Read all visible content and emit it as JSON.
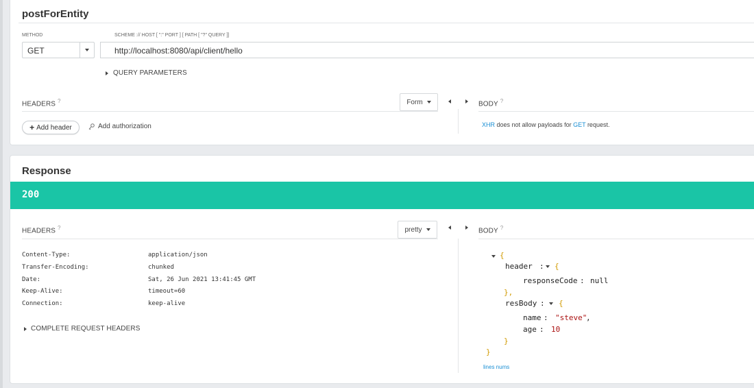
{
  "request": {
    "title": "postForEntity",
    "method_label": "METHOD",
    "method_value": "GET",
    "url_label": "SCHEME :// HOST [ \":\" PORT ] [ PATH [ \"?\" QUERY ]]",
    "url_value": "http://localhost:8080/api/client/hello",
    "query_params_label": "QUERY PARAMETERS",
    "headers_label": "HEADERS",
    "help_glyph": "?",
    "form_label": "Form",
    "add_header_label": "Add header",
    "add_auth_label": "Add authorization",
    "body_label": "BODY",
    "body_msg": {
      "xhr": "XHR",
      "middle": " does not allow payloads for ",
      "get": "GET",
      "end": " request."
    }
  },
  "response": {
    "title": "Response",
    "status": "200",
    "status_color": "#1ac5a6",
    "headers_label": "HEADERS",
    "pretty_label": "pretty",
    "body_label": "BODY",
    "headers": [
      {
        "name": "Content-Type:",
        "value": "application/json"
      },
      {
        "name": "Transfer-Encoding:",
        "value": "chunked"
      },
      {
        "name": "Date:",
        "value": "Sat, 26 Jun 2021 13:41:45 GMT"
      },
      {
        "name": "Keep-Alive:",
        "value": "timeout=60"
      },
      {
        "name": "Connection:",
        "value": "keep-alive"
      }
    ],
    "complete_headers_label": "COMPLETE REQUEST HEADERS",
    "json": {
      "open": "{",
      "close": "}",
      "close_comma": "},",
      "colon": ":",
      "header_key": "header",
      "response_code_key": "responseCode",
      "response_code_value": "null",
      "res_body_key": "resBody",
      "name_key": "name",
      "name_value": "\"steve\"",
      "name_comma": ",",
      "age_key": "age",
      "age_value": "10"
    },
    "line_nums_label": "lines nums"
  }
}
